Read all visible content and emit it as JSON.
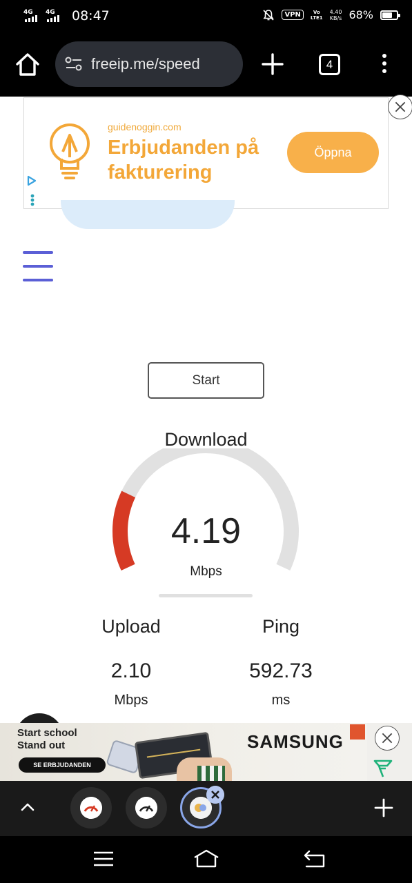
{
  "status_bar": {
    "signal1": "4G",
    "signal2": "4G",
    "time": "08:47",
    "vpn": "VPN",
    "volte_top": "Vo",
    "volte_bottom": "LTE1",
    "speed_value": "4.40",
    "speed_unit": "KB/s",
    "battery": "68%",
    "battery_level": 0.68
  },
  "browser": {
    "url": "freeip.me/speed",
    "tab_count": "4",
    "icons": [
      "home-icon",
      "site-settings-icon",
      "plus-icon",
      "tabs-icon",
      "more-vert-icon"
    ]
  },
  "top_ad": {
    "domain": "guidenoggin.com",
    "headline": "Erbjudanden på fakturering",
    "cta": "Öppna",
    "accent": "#f3a738"
  },
  "speedtest": {
    "start_label": "Start",
    "download_label": "Download",
    "download_value": "4.19",
    "download_unit": "Mbps",
    "gauge_fill": 0.22,
    "gauge_color": "#d63a24",
    "upload_label": "Upload",
    "upload_value": "2.10",
    "upload_unit": "Mbps",
    "ping_label": "Ping",
    "ping_value": "592.73",
    "ping_unit": "ms"
  },
  "bottom_ad": {
    "line1": "Start school",
    "line2": "Stand out",
    "cta": "SE ERBJUDANDEN",
    "brand": "SAMSUNG"
  },
  "dock": {
    "icons": [
      "chevron-up-icon",
      "speedometer-red-icon",
      "speedometer-icon",
      "active-tab-icon",
      "close-icon",
      "plus-icon"
    ]
  },
  "nav": {
    "icons": [
      "recent-apps-icon",
      "home-icon",
      "back-icon"
    ]
  }
}
